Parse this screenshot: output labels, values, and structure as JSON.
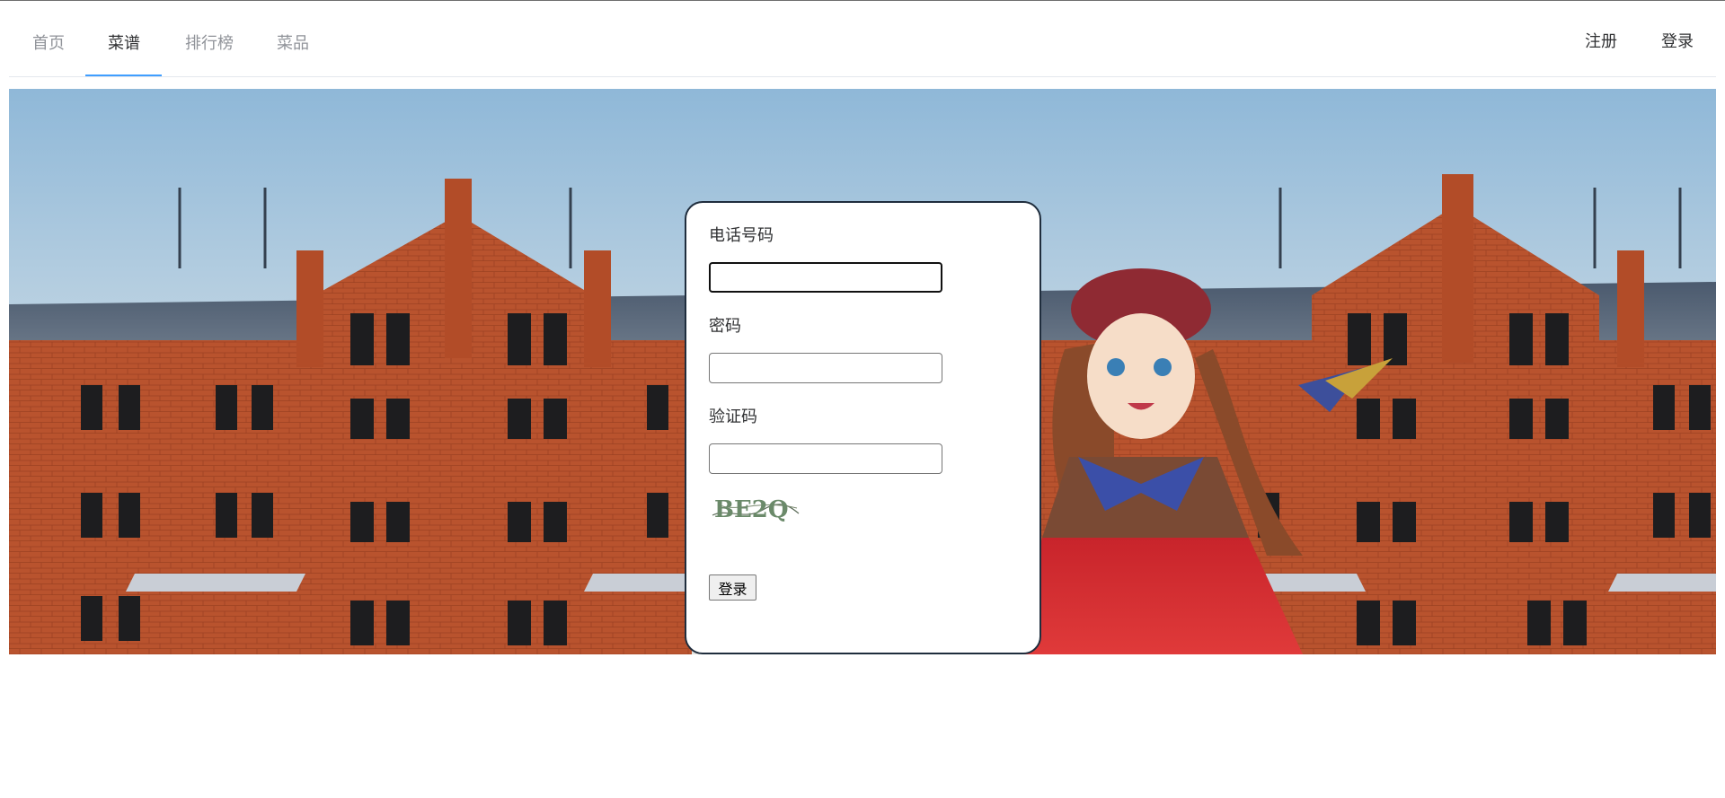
{
  "nav": {
    "tabs": [
      {
        "label": "首页"
      },
      {
        "label": "菜谱"
      },
      {
        "label": "排行榜"
      },
      {
        "label": "菜品"
      }
    ],
    "active_tab": "菜谱",
    "register_label": "注册",
    "login_label": "登录"
  },
  "login_form": {
    "phone_label": "电话号码",
    "phone_value": "",
    "password_label": "密码",
    "password_value": "",
    "captcha_label": "验证码",
    "captcha_value": "",
    "captcha_text": "BE2Q",
    "submit_label": "登录"
  },
  "colors": {
    "accent": "#409eff",
    "card_border": "#1f2d3d",
    "brick": "#b8512c"
  }
}
